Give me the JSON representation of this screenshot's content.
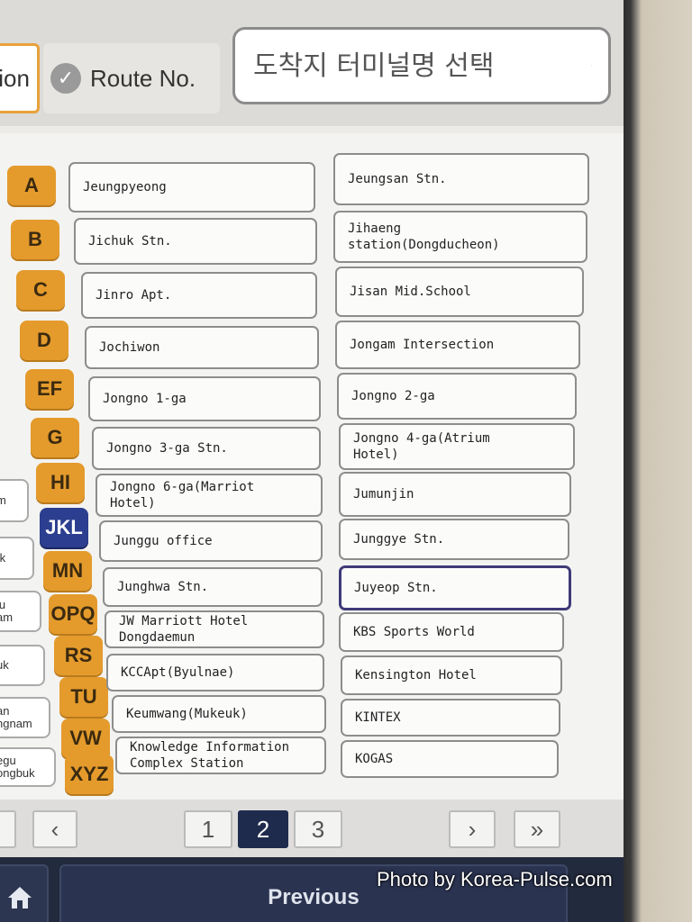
{
  "tabs": {
    "station_label": "tion",
    "route_label": "Route No."
  },
  "search": {
    "placeholder": "도착지 터미널명 선택"
  },
  "left_list": [
    {
      "label": "m"
    },
    {
      "label": "ık"
    },
    {
      "label": "ju\nam"
    },
    {
      "label": "uk"
    },
    {
      "label": "an\nngnam"
    },
    {
      "label": "egu\nongbuk"
    }
  ],
  "alphabet": [
    "A",
    "B",
    "C",
    "D",
    "EF",
    "G",
    "HI",
    "JKL",
    "MN",
    "OPQ",
    "RS",
    "TU",
    "VW",
    "XYZ"
  ],
  "active_letter": "JKL",
  "stations_col1": [
    "Jeungpyeong",
    "Jichuk Stn.",
    "Jinro Apt.",
    "Jochiwon",
    "Jongno 1-ga",
    "Jongno 3-ga Stn.",
    "Jongno 6-ga(Marriot\nHotel)",
    "Junggu office",
    "Junghwa Stn.",
    "JW Marriott Hotel\nDongdaemun",
    "KCCApt(Byulnae)",
    "Keumwang(Mukeuk)",
    "Knowledge Information\nComplex Station"
  ],
  "stations_col2": [
    "Jeungsan Stn.",
    "Jihaeng\nstation(Dongducheon)",
    "Jisan Mid.School",
    "Jongam Intersection",
    "Jongno 2-ga",
    "Jongno 4-ga(Atrium\nHotel)",
    "Jumunjin",
    "Junggye Stn.",
    "Juyeop Stn.",
    "KBS Sports World",
    "Kensington Hotel",
    "KINTEX",
    "KOGAS"
  ],
  "selected_station": "Juyeop Stn.",
  "pagination": {
    "prev": "‹",
    "pages": [
      "1",
      "2",
      "3"
    ],
    "current": "2",
    "next": "›",
    "last": "»"
  },
  "bottom": {
    "previous_label": "Previous"
  },
  "watermark": "Photo by Korea-Pulse.com",
  "colors": {
    "letter_bg": "#e49b2c",
    "letter_active_bg": "#2c3e8f",
    "selected_border": "#3f3a78",
    "bottom_bar": "#222a3d"
  }
}
